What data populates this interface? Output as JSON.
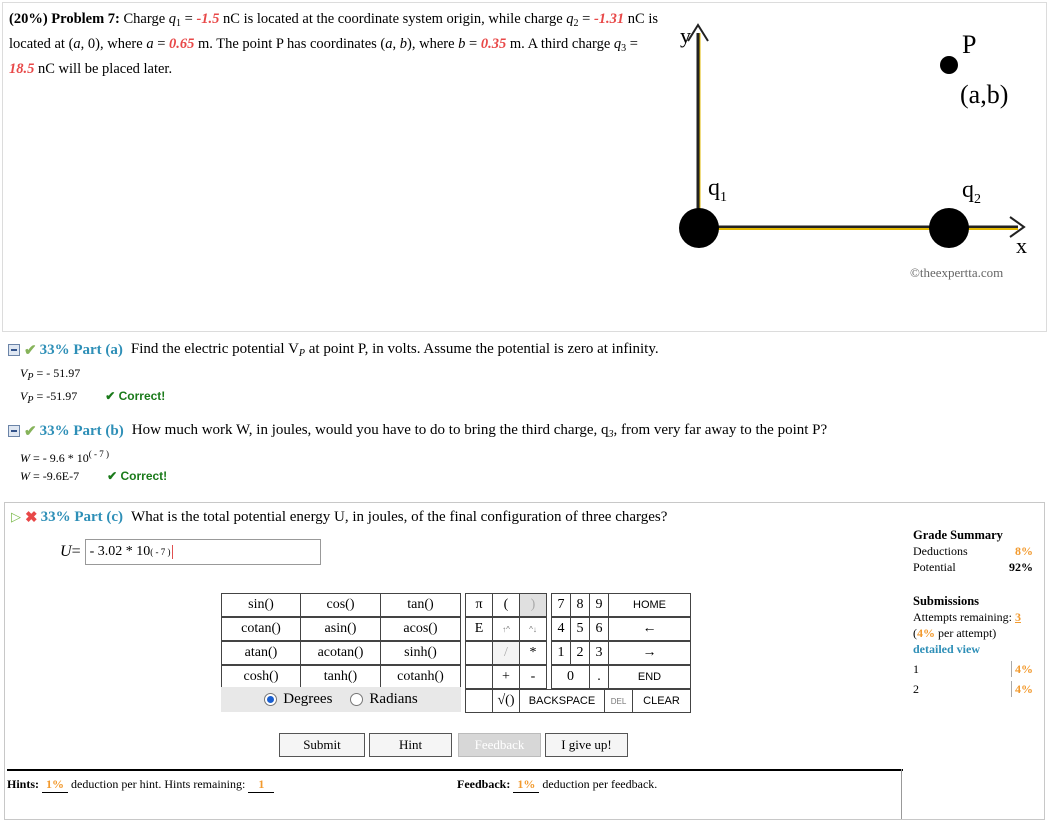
{
  "problem": {
    "weight": "(20%)",
    "label": "Problem 7:",
    "t1": "Charge",
    "q1_sym": "q",
    "q1_sub": "1",
    "eq": "=",
    "q1_val": "-1.5",
    "unit_nc": "nC",
    "t2": "is located at the coordinate system origin, while charge",
    "q2_sym": "q",
    "q2_sub": "2",
    "q2_val": "-1.31",
    "t3": "is located at (",
    "a_sym": "a",
    "t4": ", 0), where",
    "a_val": "0.65",
    "t5": "m. The point P has coordinates (",
    "b_sym": "b",
    "t6": "), where",
    "b_val": "0.35",
    "t7": "m. A third charge",
    "q3_sub": "3",
    "q3_val": "18.5",
    "t8": "nC will be placed later."
  },
  "figure": {
    "y_label": "y",
    "x_label": "x",
    "p_label": "P",
    "ab_label": "(a,b)",
    "q1_label": "q",
    "q1_sub": "1",
    "q2_label": "q",
    "q2_sub": "2",
    "copyright": "©theexpertta.com"
  },
  "part_a": {
    "pct": "33% Part (a)",
    "question": "Find the electric potential V",
    "question_sub": "P",
    "question_end": "at point P, in volts. Assume the potential is zero at infinity.",
    "ans1": "V",
    "ans1_sub": "P",
    "ans1_val": " = - 51.97",
    "ans2": "V",
    "ans2_sub": "P",
    "ans2_val": " = -51.97",
    "correct": "✔ Correct!"
  },
  "part_b": {
    "pct": "33% Part (b)",
    "question": "How much work W, in joules, would you have to do to bring the third charge, q",
    "question_sub": "3",
    "question_end": ", from very far away to the point P?",
    "ans1": "W",
    "ans1_val": " = - 9.6 * 10",
    "ans1_exp": "( - 7 )",
    "ans2": "W",
    "ans2_val": " = -9.6E-7",
    "correct": "✔ Correct!"
  },
  "part_c": {
    "pct": "33% Part (c)",
    "question": "What is the total potential energy U, in joules, of the final configuration of three charges?",
    "var": "U",
    "input_val": "- 3.02 * 10",
    "input_exp": "( - 7 )"
  },
  "keypad": {
    "functions": [
      "sin()",
      "cos()",
      "tan()",
      "cotan()",
      "asin()",
      "acos()",
      "atan()",
      "acotan()",
      "sinh()",
      "cosh()",
      "tanh()",
      "cotanh()"
    ],
    "symbols": [
      "π",
      "(",
      ")",
      "E",
      "↑^",
      "^↓",
      "",
      "/",
      "*",
      "",
      "+",
      "-",
      "",
      "√()",
      "BACKSPACE"
    ],
    "digits": [
      "7",
      "8",
      "9",
      "4",
      "5",
      "6",
      "1",
      "2",
      "3",
      "0",
      "."
    ],
    "actions": [
      "HOME",
      "←",
      "→",
      "END",
      "CLEAR"
    ],
    "del": "DEL",
    "degrees": "Degrees",
    "radians": "Radians"
  },
  "buttons": {
    "submit": "Submit",
    "hint": "Hint",
    "feedback": "Feedback",
    "give_up": "I give up!"
  },
  "grade": {
    "title": "Grade Summary",
    "deductions_label": "Deductions",
    "deductions_val": "8%",
    "potential_label": "Potential",
    "potential_val": "92%",
    "submissions_title": "Submissions",
    "attempts_label": "Attempts remaining:",
    "attempts_val": "3",
    "per_attempt_pct": "4%",
    "per_attempt_text": "per attempt)",
    "detailed": "detailed view",
    "rows": [
      {
        "n": "1",
        "v": "4%"
      },
      {
        "n": "2",
        "v": "4%"
      }
    ]
  },
  "hints": {
    "label": "Hints:",
    "pct": "1%",
    "text": "deduction per hint. Hints remaining:",
    "remaining": "1",
    "fb_label": "Feedback:",
    "fb_pct": "1%",
    "fb_text": "deduction per feedback."
  }
}
